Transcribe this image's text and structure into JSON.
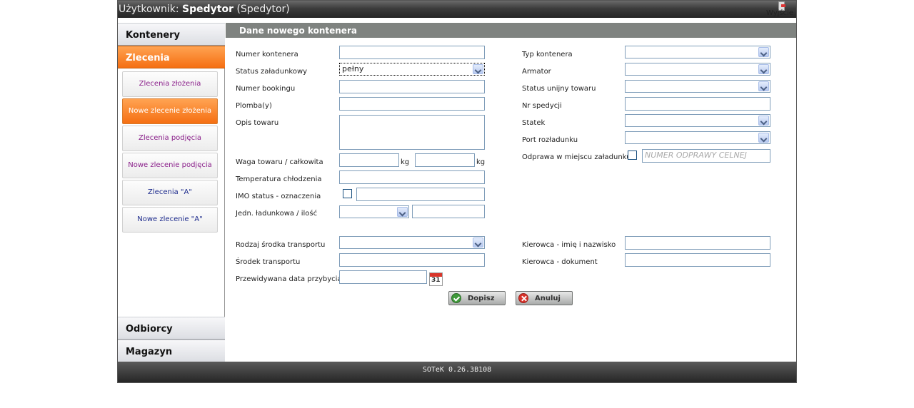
{
  "header": {
    "user_prefix": "Użytkownik:",
    "user_name": "Spedytor",
    "user_role": "(Spedytor)",
    "exit_label": "Wyjście"
  },
  "sidebar": {
    "sections": [
      {
        "label": "Kontenery"
      },
      {
        "label": "Zlecenia"
      },
      {
        "label": "Odbiorcy"
      },
      {
        "label": "Magazyn"
      }
    ],
    "sub_items": [
      {
        "label": "Zlecenia złożenia"
      },
      {
        "label": "Nowe zlecenie złożenia"
      },
      {
        "label": "Zlecenia podjęcia"
      },
      {
        "label": "Nowe zlecenie podjęcia"
      },
      {
        "label": "Zlecenia \"A\""
      },
      {
        "label": "Nowe zlecenie \"A\""
      }
    ]
  },
  "form": {
    "title": "Dane nowego kontenera",
    "left": {
      "numer_kontenera": {
        "label": "Numer kontenera",
        "value": ""
      },
      "status_zaladunkowy": {
        "label": "Status załadunkowy",
        "value": "pełny"
      },
      "numer_bookingu": {
        "label": "Numer bookingu",
        "value": ""
      },
      "plomba": {
        "label": "Plomba(y)",
        "value": ""
      },
      "opis_towaru": {
        "label": "Opis towaru",
        "value": ""
      },
      "waga": {
        "label": "Waga towaru / całkowita",
        "unit": "kg"
      },
      "temperatura": {
        "label": "Temperatura chłodzenia",
        "value": ""
      },
      "imo": {
        "label": "IMO status - oznaczenia"
      },
      "jedn": {
        "label": "Jedn. ładunkowa / ilość"
      },
      "rodzaj_transportu": {
        "label": "Rodzaj środka transportu"
      },
      "srodek_transportu": {
        "label": "Środek transportu"
      },
      "data_przybycia": {
        "label": "Przewidywana data przybycia",
        "calendar_day": "31"
      }
    },
    "right": {
      "typ_kontenera": {
        "label": "Typ kontenera"
      },
      "armator": {
        "label": "Armator"
      },
      "status_unijny": {
        "label": "Status unijny towaru"
      },
      "nr_spedycji": {
        "label": "Nr spedycji"
      },
      "statek": {
        "label": "Statek"
      },
      "port_rozladunku": {
        "label": "Port rozładunku"
      },
      "odprawa": {
        "label": "Odprawa w miejscu załadunku",
        "placeholder": "NUMER ODPRAWY CELNEJ"
      },
      "kierowca_imie": {
        "label": "Kierowca - imię i nazwisko"
      },
      "kierowca_dokument": {
        "label": "Kierowca - dokument"
      }
    },
    "buttons": {
      "submit": "Dopisz",
      "cancel": "Anuluj"
    }
  },
  "footer": {
    "version": "SOTeK 0.26.3B108"
  }
}
